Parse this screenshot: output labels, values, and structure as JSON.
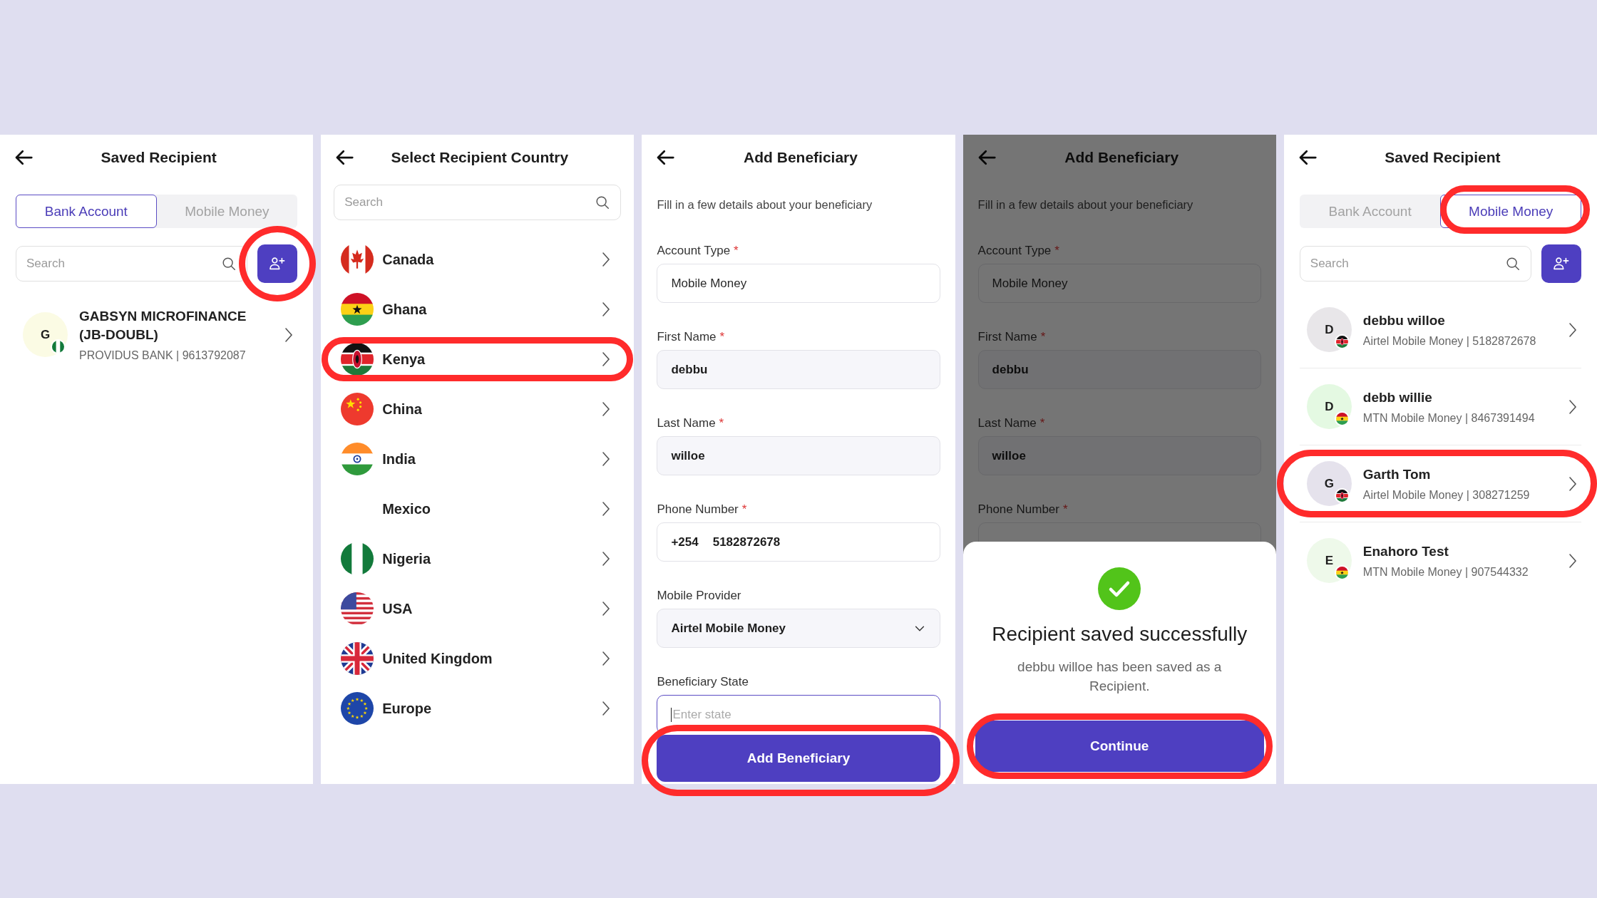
{
  "screens": [
    {
      "kind": "saved_recipients",
      "title": "Saved Recipient",
      "tabs": [
        {
          "label": "Bank Account",
          "selected": true,
          "circled": false
        },
        {
          "label": "Mobile Money",
          "selected": false,
          "circled": false
        }
      ],
      "search": {
        "placeholder": "Search"
      },
      "add_button": {
        "circled": true
      },
      "recipients": [
        {
          "initial": "G",
          "color": "#fbfbe4",
          "kind": "ng",
          "name": "GABSYN MICROFINANCE (JB-DOUBL)",
          "detail": "PROVIDUS BANK | 9613792087",
          "circled": false
        }
      ]
    },
    {
      "kind": "country_list",
      "title": "Select Recipient Country",
      "search": {
        "placeholder": "Search"
      },
      "countries": [
        {
          "name": "Canada",
          "kind": "ca",
          "circled": false
        },
        {
          "name": "Ghana",
          "kind": "gh",
          "circled": false
        },
        {
          "name": "Kenya",
          "kind": "ke",
          "circled": true
        },
        {
          "name": "China",
          "kind": "cn",
          "circled": false
        },
        {
          "name": "India",
          "kind": "in",
          "circled": false
        },
        {
          "name": "Mexico",
          "kind": "none",
          "circled": false
        },
        {
          "name": "Nigeria",
          "kind": "ng",
          "circled": false
        },
        {
          "name": "USA",
          "kind": "us",
          "circled": false
        },
        {
          "name": "United Kingdom",
          "kind": "gb",
          "circled": false
        },
        {
          "name": "Europe",
          "kind": "eu",
          "circled": false
        }
      ]
    },
    {
      "kind": "beneficiary_form",
      "title": "Add Beneficiary",
      "subtitle": "Fill in a few details about your beneficiary",
      "fields": [
        {
          "kind": "readonly",
          "label": "Account Type",
          "required_mark": "*",
          "value": "Mobile Money"
        },
        {
          "kind": "text",
          "label": "First Name",
          "required_mark": "*",
          "value": "debbu"
        },
        {
          "kind": "text",
          "label": "Last Name",
          "required_mark": "*",
          "value": "willoe"
        },
        {
          "kind": "phone",
          "label": "Phone Number",
          "required_mark": "*",
          "prefix": "+254",
          "value": "5182872678"
        },
        {
          "kind": "select",
          "label": "Mobile Provider",
          "value": "Airtel Mobile Money"
        },
        {
          "kind": "input",
          "label": "Beneficiary State",
          "placeholder": "Enter state",
          "focused": true
        }
      ],
      "submit": {
        "label": "Add Beneficiary",
        "circled": true
      }
    },
    {
      "kind": "beneficiary_form",
      "title": "Add Beneficiary",
      "subtitle": "Fill in a few details about your beneficiary",
      "dimmed": true,
      "fields": [
        {
          "kind": "readonly",
          "label": "Account Type",
          "required_mark": "*",
          "value": "Mobile Money"
        },
        {
          "kind": "text",
          "label": "First Name",
          "required_mark": "*",
          "value": "debbu"
        },
        {
          "kind": "text",
          "label": "Last Name",
          "required_mark": "*",
          "value": "willoe"
        },
        {
          "kind": "phone",
          "label": "Phone Number",
          "required_mark": "*"
        }
      ],
      "dialog": {
        "title": "Recipient saved successfully",
        "message": "debbu willoe has been saved as a Recipient.",
        "button": {
          "label": "Continue",
          "circled": true
        }
      }
    },
    {
      "kind": "saved_recipients",
      "title": "Saved Recipient",
      "tabs": [
        {
          "label": "Bank Account",
          "selected": false,
          "circled": false
        },
        {
          "label": "Mobile Money",
          "selected": true,
          "circled": true
        }
      ],
      "search": {
        "placeholder": "Search"
      },
      "add_button": {
        "circled": false
      },
      "recipients": [
        {
          "initial": "D",
          "color": "#e8e6e9",
          "kind": "ke",
          "name": "debbu willoe",
          "detail": "Airtel Mobile Money | 5182872678",
          "circled": false
        },
        {
          "initial": "D",
          "color": "#e4f9e2",
          "kind": "gh",
          "name": "debb willie",
          "detail": "MTN Mobile Money | 8467391494",
          "circled": false
        },
        {
          "initial": "G",
          "color": "#e5e2ec",
          "kind": "ke",
          "name": "Garth Tom",
          "detail": "Airtel Mobile Money | 308271259",
          "circled": true
        },
        {
          "initial": "E",
          "color": "#eef9ea",
          "kind": "gh",
          "name": "Enahoro  Test",
          "detail": "MTN Mobile Money | 907544332",
          "circled": false
        }
      ]
    }
  ]
}
